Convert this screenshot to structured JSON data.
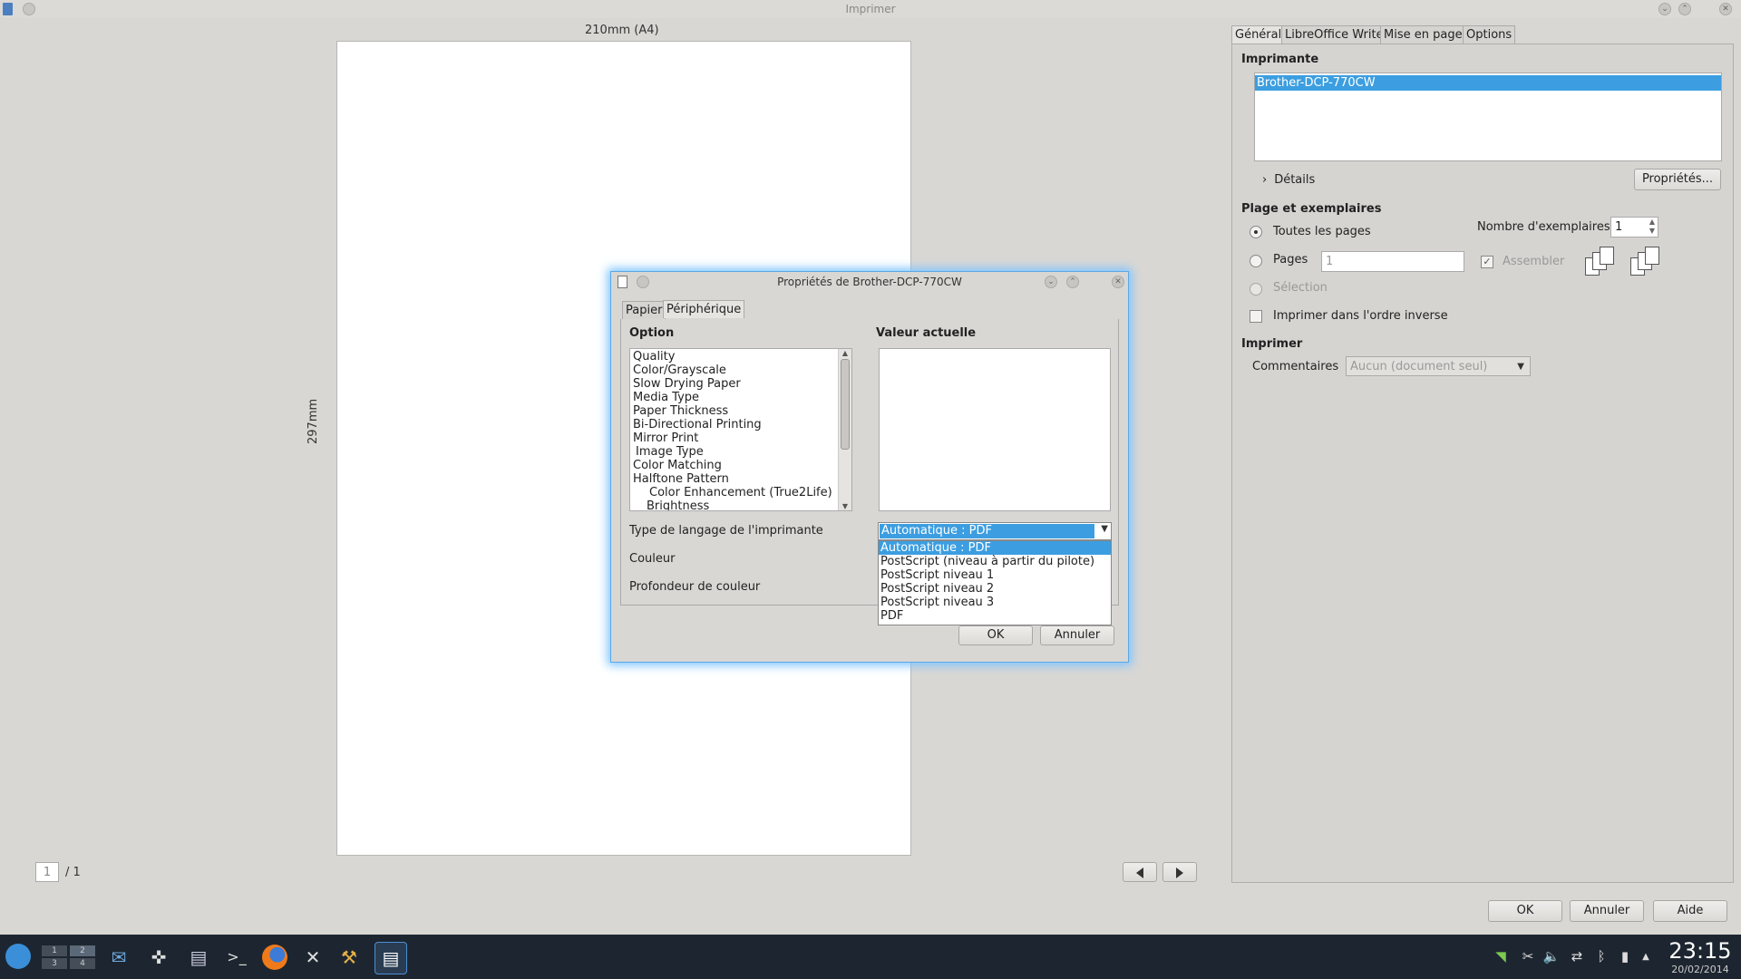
{
  "window": {
    "title": "Imprimer"
  },
  "preview": {
    "width_label": "210mm (A4)",
    "height_label": "297mm",
    "page_current": "1",
    "page_total": "/ 1"
  },
  "tabs": {
    "general": "Général",
    "writer": "LibreOffice Writer",
    "layout": "Mise en page",
    "options": "Options"
  },
  "printer": {
    "heading": "Imprimante",
    "selected": "Brother-DCP-770CW",
    "details_label": "Détails",
    "properties_button": "Propriétés..."
  },
  "range": {
    "heading": "Plage et exemplaires",
    "all_pages": "Toutes les pages",
    "pages": "Pages",
    "pages_value": "1",
    "selection": "Sélection",
    "reverse": "Imprimer dans l'ordre inverse",
    "copies_label": "Nombre d'exemplaires",
    "copies_value": "1",
    "collate": "Assembler"
  },
  "print_section": {
    "heading": "Imprimer",
    "comments_label": "Commentaires",
    "comments_value": "Aucun (document seul)"
  },
  "footer_buttons": {
    "ok": "OK",
    "cancel": "Annuler",
    "help": "Aide"
  },
  "dialog": {
    "title": "Propriétés de Brother-DCP-770CW",
    "tab_paper": "Papier",
    "tab_device": "Périphérique",
    "option_header": "Option",
    "value_header": "Valeur actuelle",
    "options": [
      {
        "label": "Quality"
      },
      {
        "label": "Color/Grayscale"
      },
      {
        "label": "Slow Drying Paper"
      },
      {
        "label": "Media Type"
      },
      {
        "label": "Paper Thickness"
      },
      {
        "label": "Bi-Directional Printing"
      },
      {
        "label": "Mirror Print"
      },
      {
        "label": "Image Type"
      },
      {
        "label": "Color Matching"
      },
      {
        "label": "Halftone Pattern"
      },
      {
        "label": "Color Enhancement (True2Life)"
      },
      {
        "label": "Brightness"
      }
    ],
    "lang_label": "Type de langage de l'imprimante",
    "lang_value": "Automatique : PDF",
    "color_label": "Couleur",
    "depth_label": "Profondeur de couleur",
    "dropdown_options": [
      "Automatique : PDF",
      "PostScript (niveau à partir du pilote)",
      "PostScript niveau 1",
      "PostScript niveau 2",
      "PostScript niveau 3",
      "PDF"
    ],
    "ok": "OK",
    "cancel": "Annuler"
  },
  "taskbar": {
    "clock": "23:15",
    "date": "20/02/2014",
    "pager": [
      "1",
      "2",
      "3",
      "4"
    ]
  },
  "colors": {
    "selection": "#3c9ee0",
    "taskbar": "#1d2630",
    "dialog_glow": "#7cc4ff"
  }
}
